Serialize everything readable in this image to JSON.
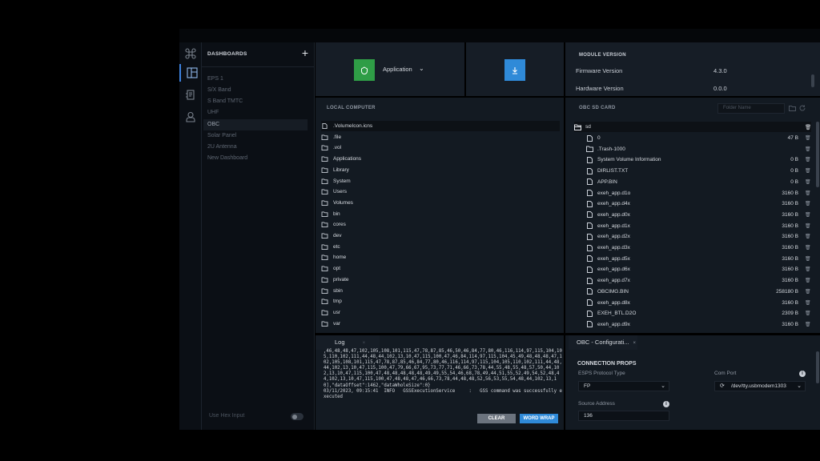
{
  "sidebar": {
    "title": "DASHBOARDS",
    "add": "+",
    "items": [
      "EPS 1",
      "S/X Band",
      "S Band TMTC",
      "UHF",
      "OBC",
      "Solar Panel",
      "2U Antenna",
      "New Dashboard"
    ],
    "active": "OBC",
    "hex_input_label": "Use Hex Input",
    "hex_input_on": false
  },
  "rail": {
    "icons": [
      "command-icon",
      "dashboard-icon",
      "scripts-icon",
      "user-icon"
    ]
  },
  "toolbar": {
    "app_select": "Application",
    "module": {
      "title": "MODULE VERSION",
      "firmware_label": "Firmware Version",
      "firmware_value": "4.3.0",
      "hardware_label": "Hardware Version",
      "hardware_value": "0.0.0"
    }
  },
  "local": {
    "title": "LOCAL COMPUTER",
    "files": [
      ".VolumeIcon.icns",
      ".file",
      ".vol",
      "Applications",
      "Library",
      "System",
      "Users",
      "Volumes",
      "bin",
      "cores",
      "dev",
      "etc",
      "home",
      "opt",
      "private",
      "sbin",
      "tmp",
      "usr",
      "var"
    ]
  },
  "sdcard": {
    "title": "OBC SD CARD",
    "folder_placeholder": "Folder Name",
    "root": "sd",
    "entries": [
      {
        "name": "0",
        "size": "47 B",
        "kind": "file"
      },
      {
        "name": ".Trash-1000",
        "size": "",
        "kind": "folder"
      },
      {
        "name": "System Volume Information",
        "size": "0 B",
        "kind": "file"
      },
      {
        "name": "DIRLIST.TXT",
        "size": "0 B",
        "kind": "file"
      },
      {
        "name": "APP.BIN",
        "size": "0 B",
        "kind": "file"
      },
      {
        "name": "exeh_app.d1o",
        "size": "3160 B",
        "kind": "file"
      },
      {
        "name": "exeh_app.d4x",
        "size": "3160 B",
        "kind": "file"
      },
      {
        "name": "exeh_app.d0x",
        "size": "3160 B",
        "kind": "file"
      },
      {
        "name": "exeh_app.d1x",
        "size": "3160 B",
        "kind": "file"
      },
      {
        "name": "exeh_app.d2x",
        "size": "3160 B",
        "kind": "file"
      },
      {
        "name": "exeh_app.d3x",
        "size": "3160 B",
        "kind": "file"
      },
      {
        "name": "exeh_app.d5x",
        "size": "3160 B",
        "kind": "file"
      },
      {
        "name": "exeh_app.d6x",
        "size": "3160 B",
        "kind": "file"
      },
      {
        "name": "exeh_app.d7x",
        "size": "3160 B",
        "kind": "file"
      },
      {
        "name": "OBCIMG.BIN",
        "size": "258180 B",
        "kind": "file"
      },
      {
        "name": "exeh_app.d8x",
        "size": "3160 B",
        "kind": "file"
      },
      {
        "name": "EXEH_BTL.D2O",
        "size": "2309 B",
        "kind": "file"
      },
      {
        "name": "exeh_app.d9x",
        "size": "3160 B",
        "kind": "file"
      }
    ]
  },
  "log": {
    "tab": "Log",
    "text": ",46,48,48,47,102,105,108,101,115,47,78,87,85,46,50,46,84,77,80,46,116,114,97,115,104,105,110,102,111,44,48,44,102,13,10,47,115,100,47,46,84,114,97,115,104,45,49,48,48,48,47,102,105,108,101,115,47,78,87,85,46,84,77,80,46,116,114,97,115,104,105,110,102,111,44,48,44,102,13,10,47,115,100,47,79,66,67,95,73,77,71,46,66,73,78,44,55,48,55,48,57,50,44,102,13,10,47,115,100,47,48,48,48,48,48,49,49,55,54,46,68,78,49,44,51,55,52,49,54,52,48,44,102,13,10,47,115,100,47,48,48,47,46,66,73,78,44,48,48,52,56,53,55,54,48,44,102,13,10],\"dataOffset\":1462,\"dataWholeSize\":0}\n03/11/2023, 09:15:41  INFO   GSSExecutionService     :   GSS command was successfully executed",
    "clear": "CLEAR",
    "wrap": "WORD WRAP"
  },
  "config": {
    "tab": "OBC - Configurati...",
    "section": "CONNECTION PROPS",
    "protocol_label": "ESPS Protocol Type",
    "protocol_value": "FP",
    "port_label": "Com Port",
    "port_value": "/dev/tty.usbmodem1303",
    "address_label": "Source Address",
    "address_value": "136"
  },
  "colors": {
    "accent": "#3d82e0",
    "green": "#2f9d46",
    "blue": "#2f8ad8"
  }
}
